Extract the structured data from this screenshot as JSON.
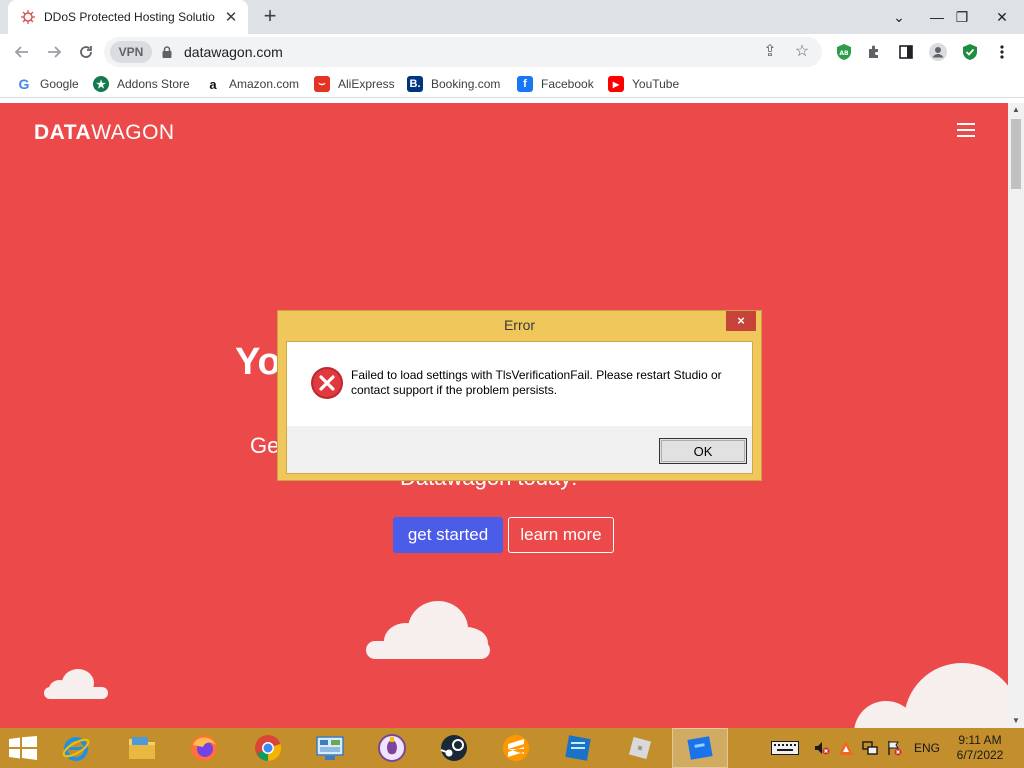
{
  "browser": {
    "tab": {
      "title": "DDoS Protected Hosting Solutio",
      "favicon": "virus-icon"
    },
    "url": "datawagon.com",
    "vpn_label": "VPN",
    "bookmarks": [
      {
        "label": "Google",
        "icon": "google-icon"
      },
      {
        "label": "Addons Store",
        "icon": "addons-store-icon"
      },
      {
        "label": "Amazon.com",
        "icon": "amazon-icon"
      },
      {
        "label": "AliExpress",
        "icon": "aliexpress-icon"
      },
      {
        "label": "Booking.com",
        "icon": "booking-icon"
      },
      {
        "label": "Facebook",
        "icon": "facebook-icon"
      },
      {
        "label": "YouTube",
        "icon": "youtube-icon"
      }
    ],
    "extension_badge": "AB"
  },
  "page": {
    "brand_bold": "DATA",
    "brand_light": "WAGON",
    "hero_heading": "Yo                                                   a",
    "hero_sub_1": "Ge",
    "hero_sub_2": "Datawagon today!",
    "cta_primary": "get started",
    "cta_secondary": "learn more"
  },
  "dialog": {
    "title": "Error",
    "close_label": "×",
    "message": "Failed to load settings with TlsVerificationFail. Please restart Studio or contact support if the problem persists.",
    "ok_label": "OK"
  },
  "taskbar": {
    "apps": [
      "internet-explorer",
      "file-explorer",
      "firefox",
      "chrome",
      "control-panel",
      "tor-browser",
      "steam",
      "sublime-text",
      "app-blue",
      "roblox-studio",
      "roblox"
    ],
    "language": "ENG",
    "time": "9:11 AM",
    "date": "6/7/2022"
  },
  "colors": {
    "page_bg": "#ec4a4a",
    "cta_primary": "#4b5de8",
    "taskbar": "#c28f2c",
    "dialog_frame": "#f0c75a",
    "dialog_close": "#c7433a"
  }
}
